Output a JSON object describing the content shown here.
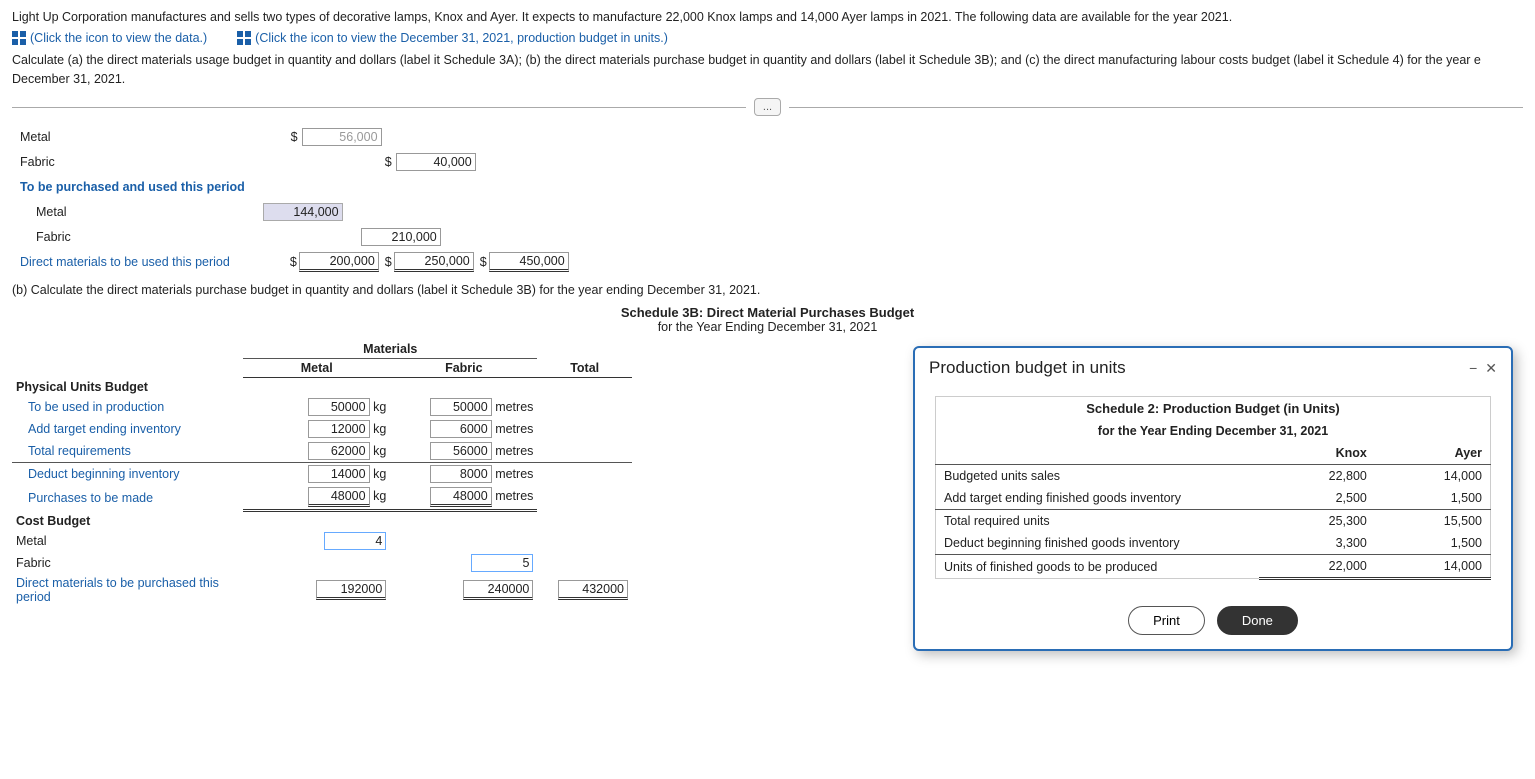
{
  "intro": {
    "text": "Light Up Corporation manufactures and sells two types of decorative lamps, Knox and Ayer. It expects to manufacture 22,000 Knox lamps and 14,000 Ayer lamps in 2021. The following data are available for the year 2021.",
    "link1": "(Click the icon to view the data.)",
    "link2": "(Click the icon to view the December 31, 2021, production budget in units.)"
  },
  "instruction": {
    "text": "Calculate (a) the direct materials usage budget in quantity and dollars (label it Schedule 3A); (b) the direct materials purchase budget in quantity and dollars (label it Schedule 3B); and (c) the direct manufacturing labour costs budget (label it Schedule 4) for the year e December 31, 2021."
  },
  "divider": {
    "btn_label": "..."
  },
  "upper_rows": [
    {
      "label": "Metal",
      "col1": "$ 56,000",
      "col2": "",
      "col3": ""
    },
    {
      "label": "Fabric",
      "col1": "",
      "col2": "$ 40,000",
      "col3": ""
    },
    {
      "label": "To be purchased and used this period",
      "bold": true,
      "blue": true,
      "col1": "",
      "col2": "",
      "col3": ""
    },
    {
      "label": "Metal",
      "indent": true,
      "col1": "144,000",
      "col2": "",
      "col3": ""
    },
    {
      "label": "Fabric",
      "indent": true,
      "col1": "",
      "col2": "210,000",
      "col3": ""
    },
    {
      "label": "Direct materials to be used this period",
      "blue": true,
      "col1": "$ 200,000",
      "col2": "$ 250,000",
      "col3": "$ 450,000"
    }
  ],
  "part_b": {
    "intro": "(b) Calculate the direct materials purchase budget in quantity and dollars (label it Schedule 3B) for the year ending December 31, 2021.",
    "schedule_title": "Schedule 3B: Direct Material Purchases Budget",
    "schedule_subtitle": "for the Year Ending December 31, 2021",
    "materials_header": "Materials",
    "col_metal": "Metal",
    "col_fabric": "Fabric",
    "col_total": "Total",
    "physical_units": {
      "header": "Physical Units Budget",
      "rows": [
        {
          "label": "To be used in production",
          "metal": "50000",
          "metal_unit": "kg",
          "fabric": "50000",
          "fabric_unit": "metres"
        },
        {
          "label": "Add target ending inventory",
          "metal": "12000",
          "metal_unit": "kg",
          "fabric": "6000",
          "fabric_unit": "metres"
        },
        {
          "label": "Total requirements",
          "metal": "62000",
          "metal_unit": "kg",
          "fabric": "56000",
          "fabric_unit": "metres"
        },
        {
          "label": "Deduct beginning inventory",
          "metal": "14000",
          "metal_unit": "kg",
          "fabric": "8000",
          "fabric_unit": "metres"
        },
        {
          "label": "Purchases to be made",
          "metal": "48000",
          "metal_unit": "kg",
          "fabric": "48000",
          "fabric_unit": "metres"
        }
      ]
    },
    "cost_budget": {
      "header": "Cost Budget",
      "rows": [
        {
          "label": "Metal",
          "metal": "4",
          "fabric": "",
          "total": ""
        },
        {
          "label": "Fabric",
          "metal": "",
          "fabric": "5",
          "total": ""
        },
        {
          "label": "Direct materials to be purchased this period",
          "metal": "192000",
          "fabric": "240000",
          "total": "432000"
        }
      ]
    }
  },
  "modal": {
    "title": "Production budget in units",
    "min_label": "−",
    "close_label": "✕",
    "schedule_title": "Schedule 2: Production Budget (in Units)",
    "year_label": "for the Year Ending December 31, 2021",
    "col_knox": "Knox",
    "col_ayer": "Ayer",
    "rows": [
      {
        "label": "Budgeted units sales",
        "knox": "22,800",
        "ayer": "14,000"
      },
      {
        "label": "Add target ending finished goods inventory",
        "knox": "2,500",
        "ayer": "1,500"
      },
      {
        "label": "Total required units",
        "knox": "25,300",
        "ayer": "15,500",
        "underline": true
      },
      {
        "label": "Deduct beginning finished goods inventory",
        "knox": "3,300",
        "ayer": "1,500"
      },
      {
        "label": "Units of finished goods to be produced",
        "knox": "22,000",
        "ayer": "14,000",
        "double_underline": true
      }
    ],
    "btn_print": "Print",
    "btn_done": "Done"
  }
}
